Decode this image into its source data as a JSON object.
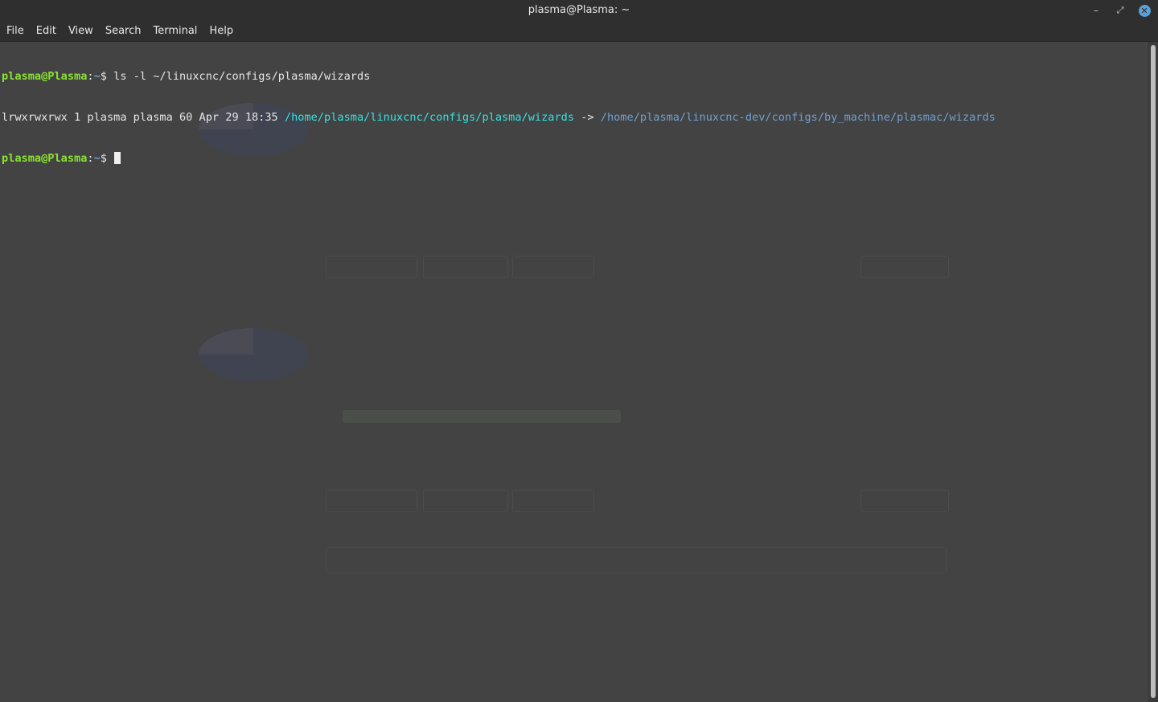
{
  "window": {
    "title": "plasma@Plasma: ~",
    "minimize_glyph": "–",
    "maximize_glyph": "⤢",
    "close_glyph": "✕"
  },
  "menu": {
    "items": [
      "File",
      "Edit",
      "View",
      "Search",
      "Terminal",
      "Help"
    ]
  },
  "terminal": {
    "line1": {
      "user": "plasma@Plasma",
      "sep": ":",
      "path": "~",
      "prompt": "$ ",
      "command": "ls -l ~/linuxcnc/configs/plasma/wizards"
    },
    "line2": {
      "listing": "lrwxrwxrwx 1 plasma plasma 60 Apr 29 18:35 ",
      "link_source": "/home/plasma/linuxcnc/configs/plasma/wizards",
      "arrow": " -> ",
      "link_target": "/home/plasma/linuxcnc-dev/configs/by_machine/plasmac/wizards"
    },
    "line3": {
      "user": "plasma@Plasma",
      "sep": ":",
      "path": "~",
      "prompt": "$ "
    }
  },
  "colors": {
    "prompt_user": "#8ae234",
    "prompt_path": "#729fcf",
    "symlink_source": "#34e2e2",
    "symlink_target": "#729fcf",
    "terminal_bg": "#474747"
  }
}
